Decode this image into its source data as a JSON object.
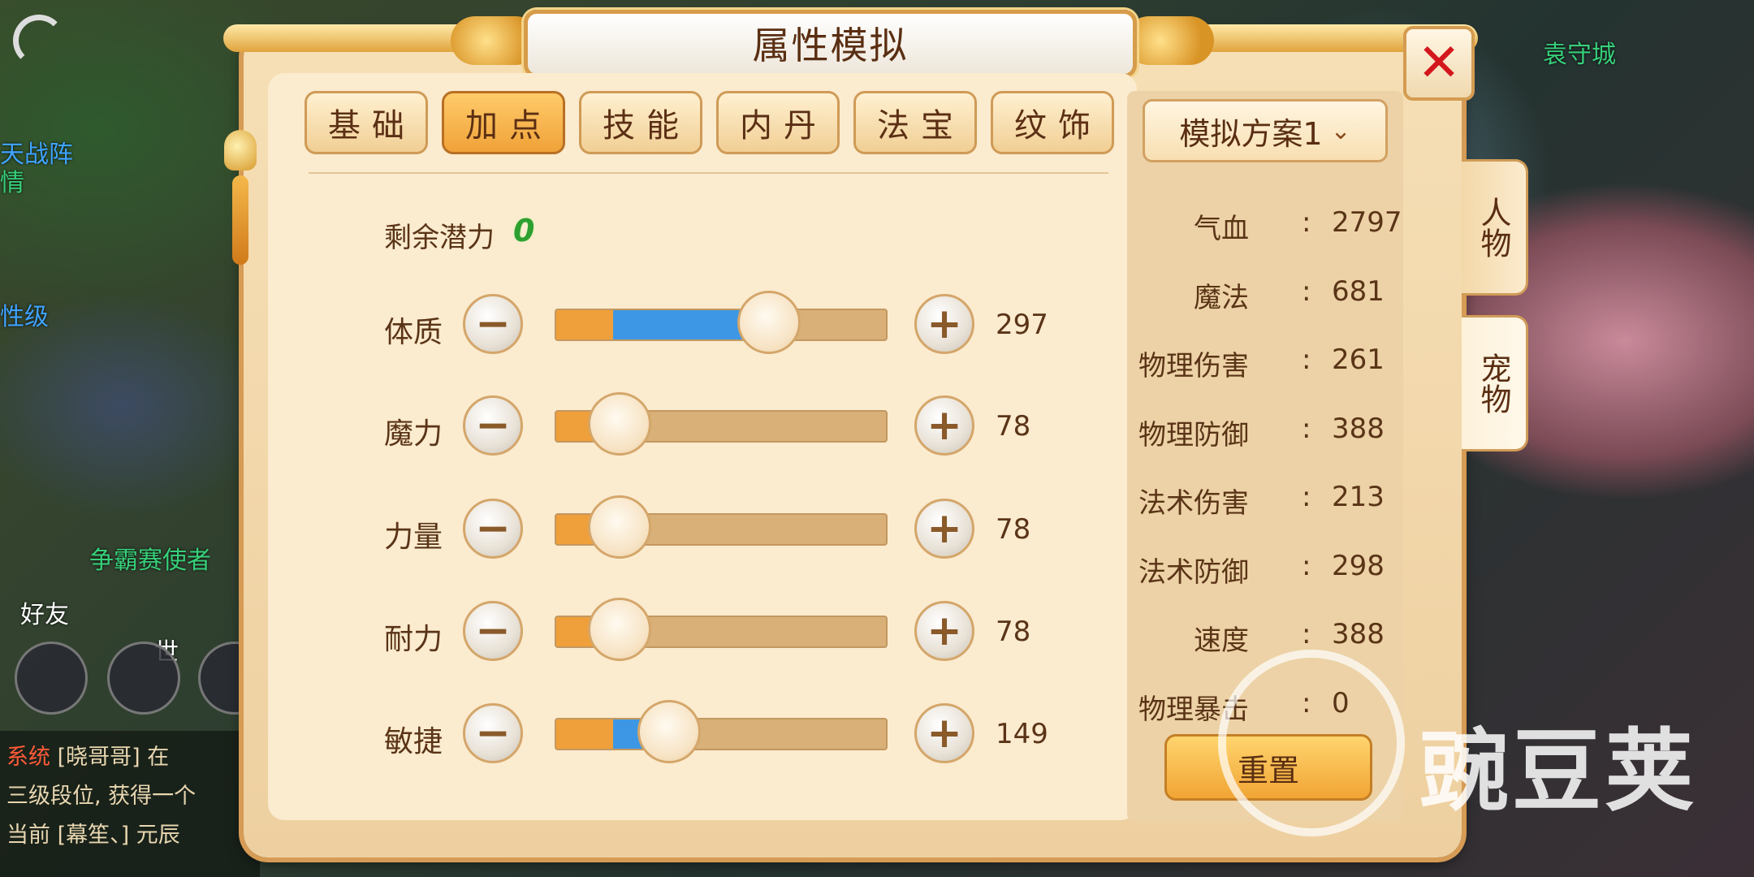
{
  "window": {
    "title": "属性模拟",
    "close_icon": "close-icon"
  },
  "tabs": [
    {
      "label": "基础",
      "active": false
    },
    {
      "label": "加点",
      "active": true
    },
    {
      "label": "技能",
      "active": false
    },
    {
      "label": "内丹",
      "active": false
    },
    {
      "label": "法宝",
      "active": false
    },
    {
      "label": "纹饰",
      "active": false
    }
  ],
  "potential": {
    "label": "剩余潜力",
    "value": "0"
  },
  "attributes": [
    {
      "label": "体质",
      "value": "297",
      "base_fraction": 0.17,
      "total_fraction": 0.62
    },
    {
      "label": "魔力",
      "value": "78",
      "base_fraction": 0.17,
      "total_fraction": 0.17
    },
    {
      "label": "力量",
      "value": "78",
      "base_fraction": 0.17,
      "total_fraction": 0.17
    },
    {
      "label": "耐力",
      "value": "78",
      "base_fraction": 0.17,
      "total_fraction": 0.17
    },
    {
      "label": "敏捷",
      "value": "149",
      "base_fraction": 0.17,
      "total_fraction": 0.32
    }
  ],
  "buttons": {
    "minus_glyph": "−",
    "plus_glyph": "+"
  },
  "plan": {
    "label": "模拟方案1",
    "chevron": "⌄"
  },
  "stats": [
    {
      "name": "气血",
      "value": "2797"
    },
    {
      "name": "魔法",
      "value": "681"
    },
    {
      "name": "物理伤害",
      "value": "261"
    },
    {
      "name": "物理防御",
      "value": "388"
    },
    {
      "name": "法术伤害",
      "value": "213"
    },
    {
      "name": "法术防御",
      "value": "298"
    },
    {
      "name": "速度",
      "value": "388"
    },
    {
      "name": "物理暴击",
      "value": "0"
    }
  ],
  "stat_colon": ":",
  "reset": {
    "label": "重置"
  },
  "side_tabs": [
    {
      "label": "人物",
      "active": false
    },
    {
      "label": "宠物",
      "active": true
    }
  ],
  "background": {
    "texts": [
      "袁守城",
      "天战阵",
      "情",
      "性级",
      "争霸赛使者",
      "好友",
      "世"
    ],
    "chat": {
      "line1_tag": "系统",
      "line1_text": "[晓哥哥] 在",
      "line2_text": "三级段位, 获得一个",
      "line3_text": "当前 [幕笙、] 元辰"
    }
  },
  "watermark": {
    "text": "豌豆荚"
  },
  "colors": {
    "accent_orange": "#f0a03a",
    "accent_blue": "#3d97e4",
    "text_brown": "#5a3417",
    "potential_green": "#2ea02f",
    "close_red": "#d4171d"
  }
}
